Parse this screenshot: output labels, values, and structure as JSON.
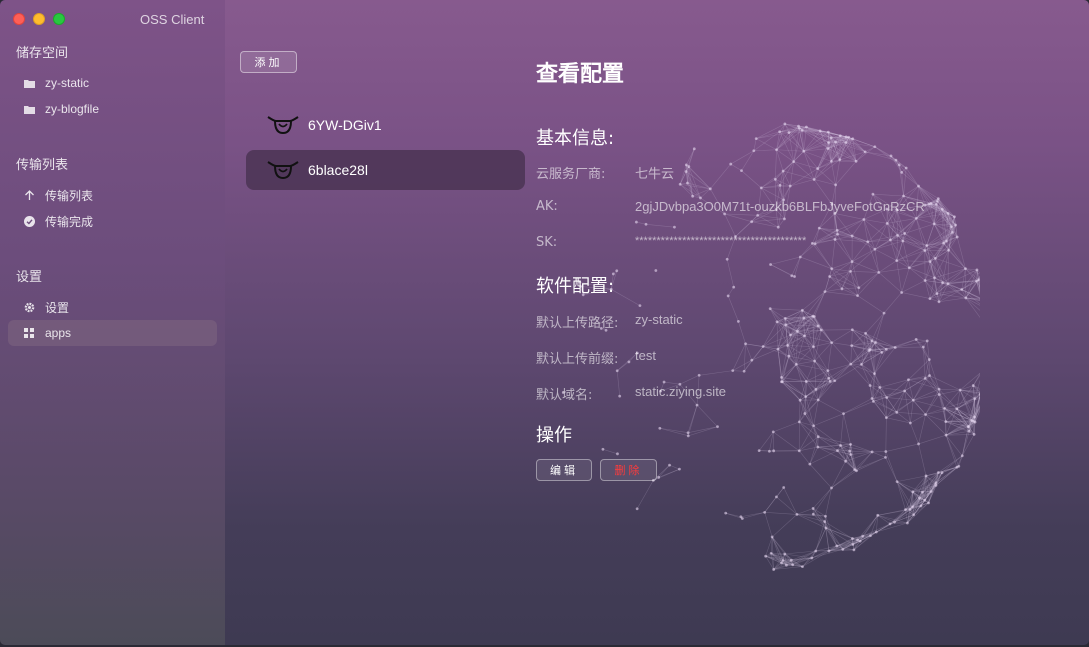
{
  "window": {
    "title": "OSS Client"
  },
  "sidebar": {
    "sections": [
      {
        "title": "储存空间",
        "items": [
          {
            "label": "zy-static",
            "icon": "folder-icon"
          },
          {
            "label": "zy-blogfile",
            "icon": "folder-icon"
          }
        ]
      },
      {
        "title": "传输列表",
        "items": [
          {
            "label": "传输列表",
            "icon": "arrow-up-icon"
          },
          {
            "label": "传输完成",
            "icon": "check-circle-icon"
          }
        ]
      },
      {
        "title": "设置",
        "items": [
          {
            "label": "设置",
            "icon": "gear-icon"
          },
          {
            "label": "apps",
            "icon": "grid-icon",
            "active": true
          }
        ]
      }
    ]
  },
  "middle": {
    "add_label": "添加",
    "apps": [
      {
        "name": "6YW-DGiv1"
      },
      {
        "name": "6blace28l",
        "active": true
      }
    ]
  },
  "detail": {
    "title": "查看配置",
    "basic": {
      "title": "基本信息:",
      "vendor_label": "云服务厂商:",
      "vendor_value": "七牛云",
      "ak_label": "AK:",
      "ak_value": "2gjJDvbpa3O0M71t-ouzkb6BLFbJyveFotGnRzCR",
      "sk_label": "SK:",
      "sk_value": "****************************************"
    },
    "software": {
      "title": "软件配置:",
      "path_label": "默认上传路径:",
      "path_value": "zy-static",
      "prefix_label": "默认上传前缀:",
      "prefix_value": "test",
      "domain_label": "默认域名:",
      "domain_value": "static.ziying.site"
    },
    "actions": {
      "title": "操作",
      "edit_label": "编辑",
      "delete_label": "删除"
    }
  },
  "colors": {
    "accent": "#7e5388",
    "danger": "#ff3b3b"
  }
}
